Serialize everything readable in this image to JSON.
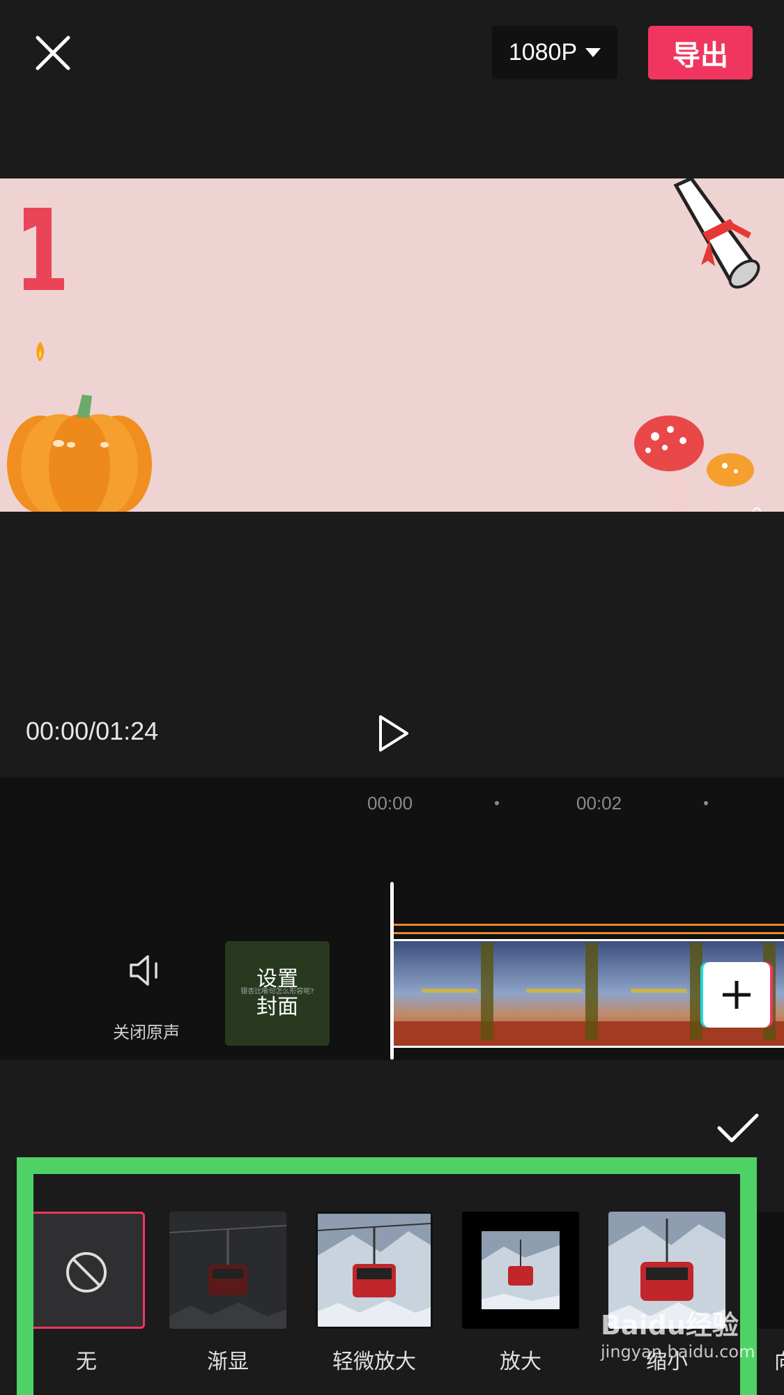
{
  "top_bar": {
    "resolution": "1080P",
    "export_label": "导出"
  },
  "playback": {
    "timecode": "00:00/01:24"
  },
  "timeline": {
    "ruler": [
      "00:00",
      "00:02"
    ],
    "mute_label": "关闭原声",
    "cover_label_line1": "设置",
    "cover_label_line2": "封面",
    "cover_subtext": "银杏比喻句怎么形容呢?"
  },
  "effects": [
    {
      "label": "无"
    },
    {
      "label": "渐显"
    },
    {
      "label": "轻微放大"
    },
    {
      "label": "放大"
    },
    {
      "label": "缩小"
    },
    {
      "label": "向"
    }
  ],
  "watermark": {
    "brand": "Baidu经验",
    "url": "jingyan.baidu.com"
  },
  "colors": {
    "accent": "#f0365f",
    "highlight_frame": "#4fd265",
    "preview_bg": "#efd3d2"
  }
}
